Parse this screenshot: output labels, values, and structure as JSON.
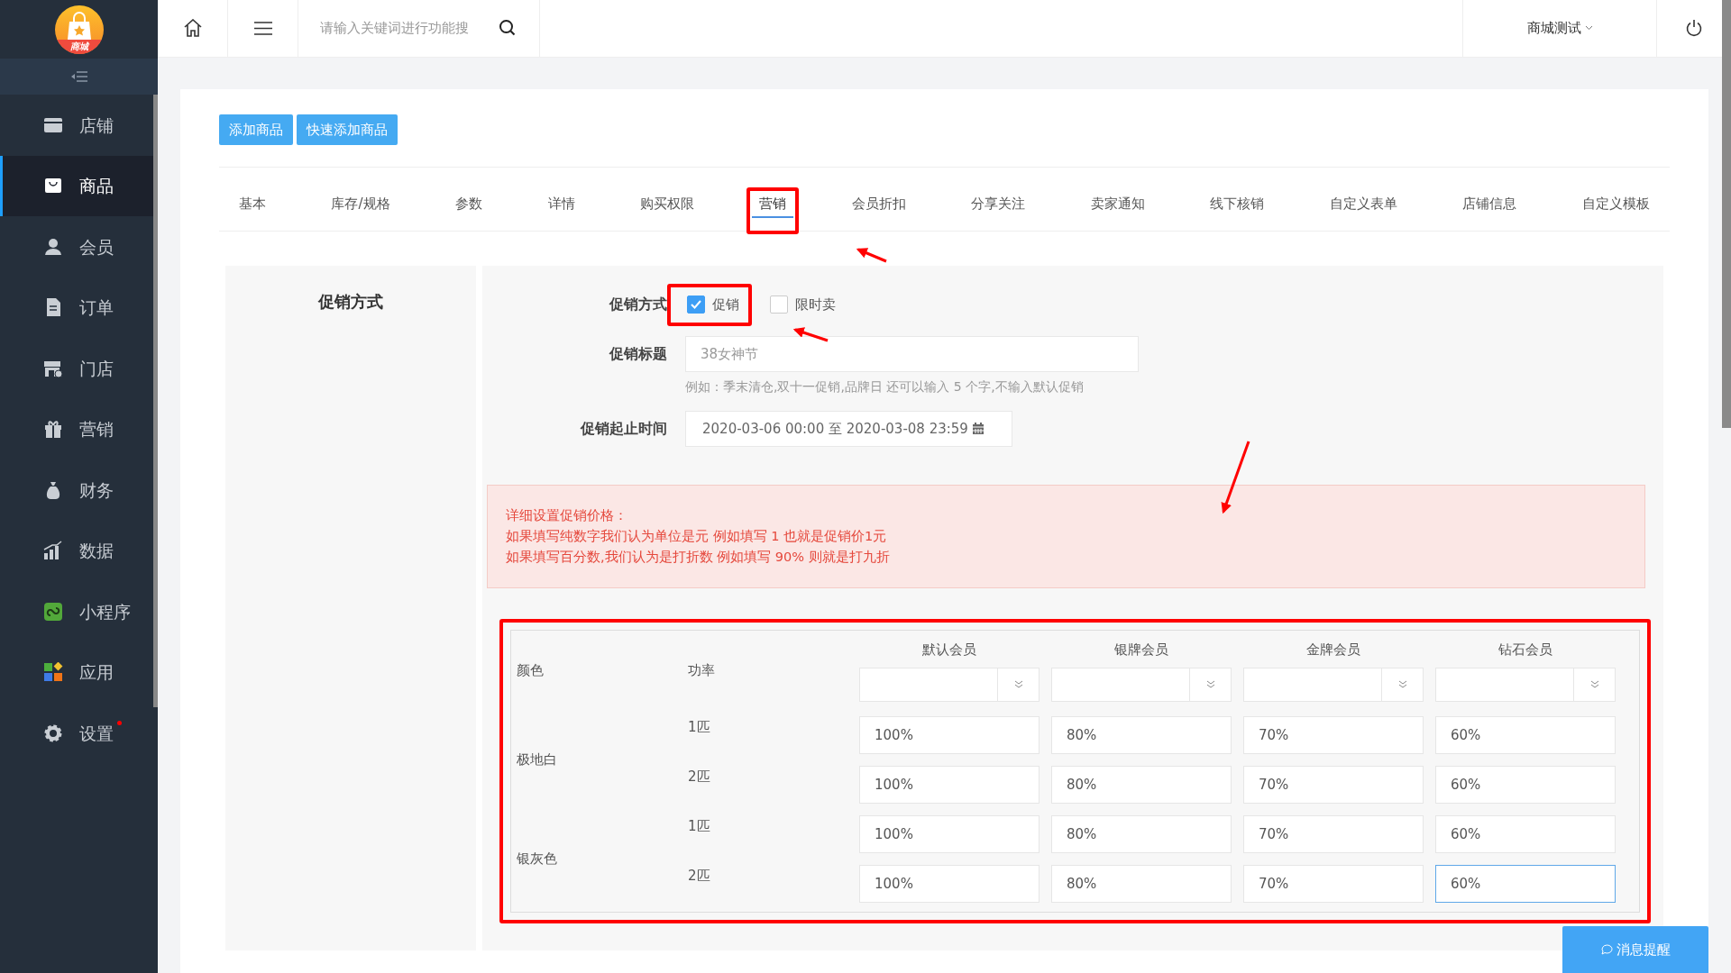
{
  "logo": {
    "text": "商城"
  },
  "sidebar": {
    "items": [
      {
        "label": "店铺",
        "selected": false,
        "dot": false
      },
      {
        "label": "商品",
        "selected": true,
        "dot": false
      },
      {
        "label": "会员",
        "selected": false,
        "dot": false
      },
      {
        "label": "订单",
        "selected": false,
        "dot": false
      },
      {
        "label": "门店",
        "selected": false,
        "dot": false
      },
      {
        "label": "营销",
        "selected": false,
        "dot": false
      },
      {
        "label": "财务",
        "selected": false,
        "dot": false
      },
      {
        "label": "数据",
        "selected": false,
        "dot": false
      },
      {
        "label": "小程序",
        "selected": false,
        "dot": false
      },
      {
        "label": "应用",
        "selected": false,
        "dot": false
      },
      {
        "label": "设置",
        "selected": false,
        "dot": true
      }
    ]
  },
  "header": {
    "search": {
      "placeholder": "请输入关键词进行功能搜"
    },
    "store": "商城测试"
  },
  "toolbar": [
    "添加商品",
    "快速添加商品"
  ],
  "tabs": [
    {
      "label": "基本",
      "selected": false
    },
    {
      "label": "库存/规格",
      "selected": false
    },
    {
      "label": "参数",
      "selected": false
    },
    {
      "label": "详情",
      "selected": false
    },
    {
      "label": "购买权限",
      "selected": false
    },
    {
      "label": "营销",
      "selected": true
    },
    {
      "label": "会员折扣",
      "selected": false
    },
    {
      "label": "分享关注",
      "selected": false
    },
    {
      "label": "卖家通知",
      "selected": false
    },
    {
      "label": "线下核销",
      "selected": false
    },
    {
      "label": "自定义表单",
      "selected": false
    },
    {
      "label": "店铺信息",
      "selected": false
    },
    {
      "label": "自定义模板",
      "selected": false
    }
  ],
  "section": {
    "title": "促销方式",
    "promo_type": {
      "label": "促销方式",
      "options": [
        {
          "label": "促销",
          "checked": true
        },
        {
          "label": "限时卖",
          "checked": false
        }
      ]
    },
    "promo_title": {
      "label": "促销标题",
      "placeholder": "38女神节"
    },
    "hint": "例如：季末清仓,双十一促销,品牌日 还可以输入 5 个字,不输入默认促销",
    "period": {
      "label": "促销起止时间",
      "value": "2020-03-06 00:00 至 2020-03-08 23:59"
    },
    "notice": [
      "详细设置促销价格：",
      "如果填写纯数字我们认为单位是元 例如填写 1 也就是促销价1元",
      "如果填写百分数,我们认为是打折数 例如填写 90% 则就是打九折"
    ],
    "table": {
      "columns": [
        "颜色",
        "功率"
      ],
      "levels": [
        "默认会员",
        "银牌会员",
        "金牌会员",
        "钻石会员"
      ],
      "groups": [
        {
          "variant": "极地白",
          "rows": [
            {
              "power": "1匹",
              "prices": [
                {
                  "value": "100%",
                  "focused": false
                },
                {
                  "value": "80%",
                  "focused": false
                },
                {
                  "value": "70%",
                  "focused": false
                },
                {
                  "value": "60%",
                  "focused": false
                }
              ]
            },
            {
              "power": "2匹",
              "prices": [
                {
                  "value": "100%",
                  "focused": false
                },
                {
                  "value": "80%",
                  "focused": false
                },
                {
                  "value": "70%",
                  "focused": false
                },
                {
                  "value": "60%",
                  "focused": false
                }
              ]
            }
          ]
        },
        {
          "variant": "银灰色",
          "rows": [
            {
              "power": "1匹",
              "prices": [
                {
                  "value": "100%",
                  "focused": false
                },
                {
                  "value": "80%",
                  "focused": false
                },
                {
                  "value": "70%",
                  "focused": false
                },
                {
                  "value": "60%",
                  "focused": false
                }
              ]
            },
            {
              "power": "2匹",
              "prices": [
                {
                  "value": "100%",
                  "focused": false
                },
                {
                  "value": "80%",
                  "focused": false
                },
                {
                  "value": "70%",
                  "focused": false
                },
                {
                  "value": "60%",
                  "focused": true
                }
              ]
            }
          ]
        }
      ]
    }
  },
  "message_button": "消息提醒"
}
